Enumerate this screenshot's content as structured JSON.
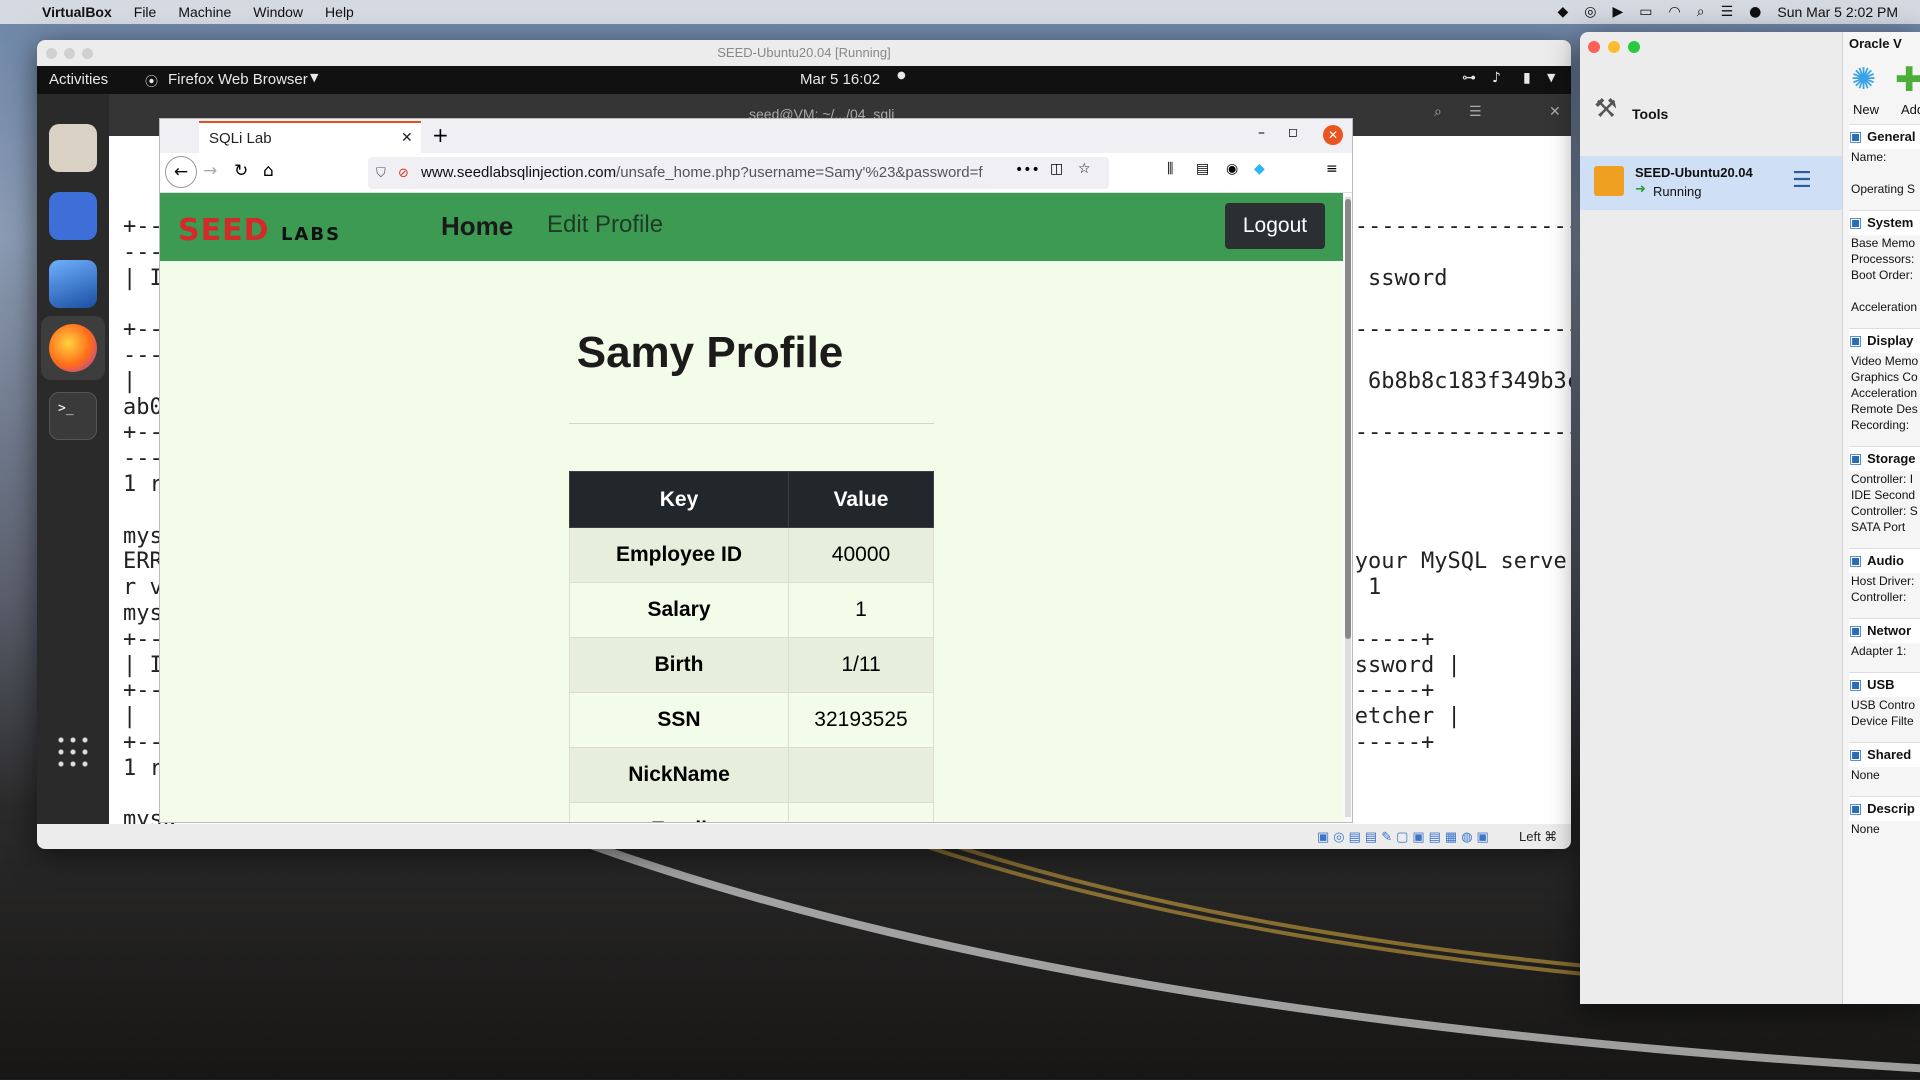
{
  "mac_menubar": {
    "app": "VirtualBox",
    "menus": [
      "File",
      "Machine",
      "Window",
      "Help"
    ],
    "datetime": "Sun Mar 5  2:02 PM"
  },
  "vm_window": {
    "title": "SEED-Ubuntu20.04 [Running]",
    "status_right": "Left ⌘"
  },
  "ubuntu_bar": {
    "activities": "Activities",
    "app": "Firefox Web Browser",
    "clock": "Mar 5  16:02"
  },
  "terminal": {
    "title": "seed@VM: ~/.../04_sqli",
    "lines": [
      "+---------------------------------------------------------------------------------------------------------------",
      "----",
      "| ID                                                                                          ssword",
      "",
      "+---------------------------------------------------------------------------------------------------------------",
      "----",
      "|  4                                                                                          6b8b8c183f349b3c",
      "ab0a",
      "+---------------------------------------------------------------------------------------------------------------",
      "----",
      "1 ro",
      "",
      "mysq",
      "ERRO                                                                                         your MySQL serve",
      "r ve                                                                                          1",
      "mysq",
      "+---                                                                                      --------+",
      "| ID                                                                                         ssword |",
      "+---                                                                                      --------+",
      "|  4                                                                                         etcher |",
      "+---                                                                                      --------+",
      "1 ro",
      "",
      "mysq"
    ]
  },
  "firefox": {
    "tab_title": "SQLi Lab",
    "url_domain": "www.seedlabsqlinjection.com",
    "url_path": "/unsafe_home.php?username=Samy'%23&password=f"
  },
  "seed": {
    "logo_main": "SEED",
    "logo_sub": "LABS",
    "nav_home": "Home",
    "nav_edit": "Edit Profile",
    "logout": "Logout",
    "title": "Samy Profile",
    "table": {
      "headers": [
        "Key",
        "Value"
      ],
      "rows": [
        [
          "Employee ID",
          "40000"
        ],
        [
          "Salary",
          "1"
        ],
        [
          "Birth",
          "1/11"
        ],
        [
          "SSN",
          "32193525"
        ],
        [
          "NickName",
          ""
        ],
        [
          "Email",
          ""
        ]
      ]
    }
  },
  "vbox_manager": {
    "title": "Oracle V",
    "tools": "Tools",
    "new": "New",
    "add": "Add",
    "vm_name": "SEED-Ubuntu20.04",
    "vm_state": "Running",
    "details": [
      {
        "head": "General",
        "rows": [
          "Name:",
          "",
          "Operating S"
        ]
      },
      {
        "head": "System",
        "rows": [
          "Base Memo",
          "Processors:",
          "Boot Order:",
          "",
          "Acceleration"
        ]
      },
      {
        "head": "Display",
        "rows": [
          "Video Memo",
          "Graphics Co",
          "Acceleration",
          "Remote Des",
          "Recording:"
        ]
      },
      {
        "head": "Storage",
        "rows": [
          "Controller: I",
          "  IDE Second",
          "Controller: S",
          "  SATA Port"
        ]
      },
      {
        "head": "Audio",
        "rows": [
          "Host Driver:",
          "Controller:"
        ]
      },
      {
        "head": "Networ",
        "rows": [
          "Adapter 1:"
        ]
      },
      {
        "head": "USB",
        "rows": [
          "USB Contro",
          "Device Filte"
        ]
      },
      {
        "head": "Shared",
        "rows": [
          "None"
        ]
      },
      {
        "head": "Descrip",
        "rows": [
          "None"
        ]
      }
    ]
  }
}
